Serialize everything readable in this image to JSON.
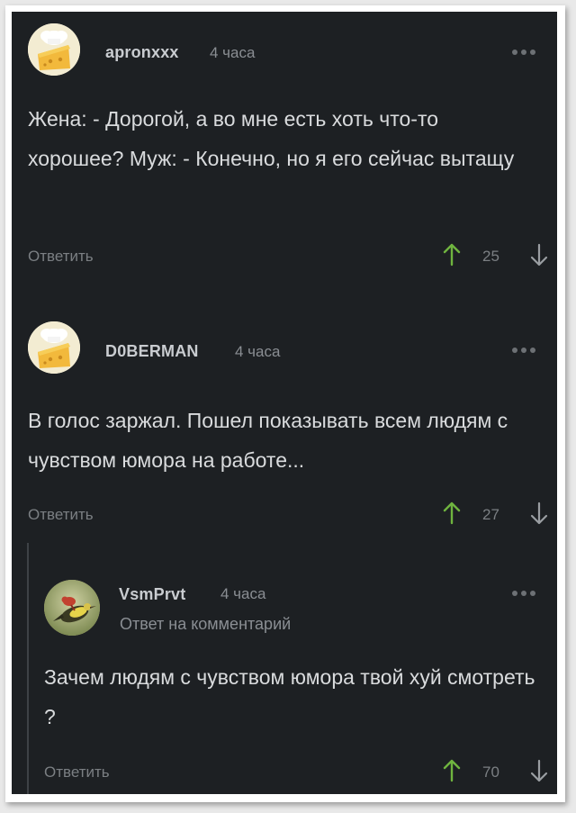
{
  "comments": [
    {
      "username": "apronxxx",
      "time": "4 часа",
      "avatar": "cheese-chef-avatar",
      "text": "Жена: - Дорогой, а во мне есть хоть что-то хорошее? Муж: - Конечно, но я его сейчас вытащу",
      "reply_label": "Ответить",
      "score": "25"
    },
    {
      "username": "D0BERMAN",
      "time": "4 часа",
      "avatar": "cheese-chef-avatar",
      "text": "В голос заржал. Пошел показывать всем людям с чувством юмора на работе...",
      "reply_label": "Ответить",
      "score": "27"
    },
    {
      "username": "VsmPrvt",
      "time": "4 часа",
      "avatar": "bird-avatar",
      "reply_to": "Ответ на комментарий",
      "text": "Зачем людям с чувством юмора твой хуй смотреть ?",
      "reply_label": "Ответить",
      "score": "70"
    }
  ],
  "colors": {
    "background": "#1d2023",
    "upvote": "#6fb43f",
    "text": "#d9dbdd",
    "muted": "#7b7f83"
  },
  "icons": [
    "more-dots-icon",
    "upvote-arrow-icon",
    "downvote-arrow-icon"
  ]
}
